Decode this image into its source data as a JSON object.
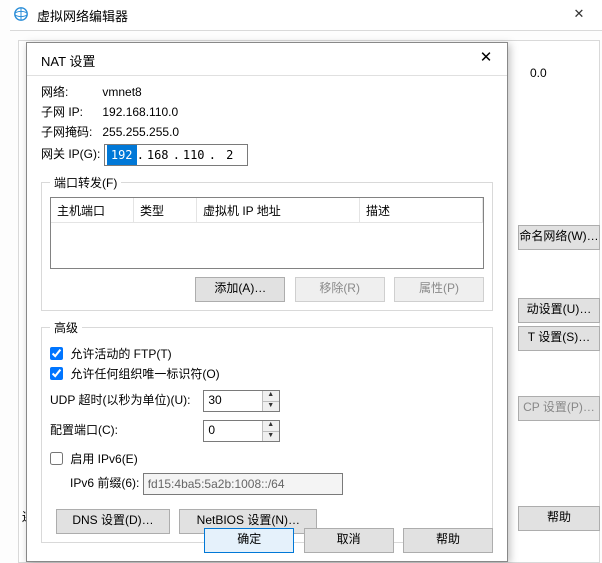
{
  "parent_window": {
    "title": "虚拟网络编辑器",
    "close_glyph": "✕",
    "ip_fragment": "0.0",
    "side_buttons": {
      "rename": "命名网络(W)…",
      "auto_cfg": "动设置(U)…",
      "nat_cfg": "T 设置(S)…",
      "dhcp_cfg": "CP 设置(P)…",
      "help": "帮助"
    },
    "bottom_left_fragment": "还"
  },
  "dialog": {
    "title": "NAT 设置",
    "close_glyph": "✕",
    "net_label": "网络:",
    "net_value": "vmnet8",
    "subnet_ip_label": "子网 IP:",
    "subnet_ip_value": "192.168.110.0",
    "mask_label": "子网掩码:",
    "mask_value": "255.255.255.0",
    "gateway_label": "网关 IP(G):",
    "gateway_octets": [
      "192",
      "168",
      "110",
      "2"
    ],
    "port_fwd": {
      "legend": "端口转发(F)",
      "cols": [
        "主机端口",
        "类型",
        "虚拟机 IP 地址",
        "描述"
      ],
      "rows": [],
      "add_btn": "添加(A)…",
      "remove_btn": "移除(R)",
      "prop_btn": "属性(P)"
    },
    "advanced": {
      "legend": "高级",
      "allow_ftp": "允许活动的 FTP(T)",
      "allow_oui": "允许任何组织唯一标识符(O)",
      "udp_label": "UDP 超时(以秒为单位)(U):",
      "udp_value": "30",
      "cfg_port_label": "配置端口(C):",
      "cfg_port_value": "0",
      "ipv6_enable": "启用 IPv6(E)",
      "ipv6_prefix_label": "IPv6 前缀(6):",
      "ipv6_prefix_value": "fd15:4ba5:5a2b:1008::/64",
      "dns_btn": "DNS 设置(D)…",
      "netbios_btn": "NetBIOS 设置(N)…"
    },
    "footer": {
      "ok": "确定",
      "cancel": "取消",
      "help": "帮助"
    }
  }
}
